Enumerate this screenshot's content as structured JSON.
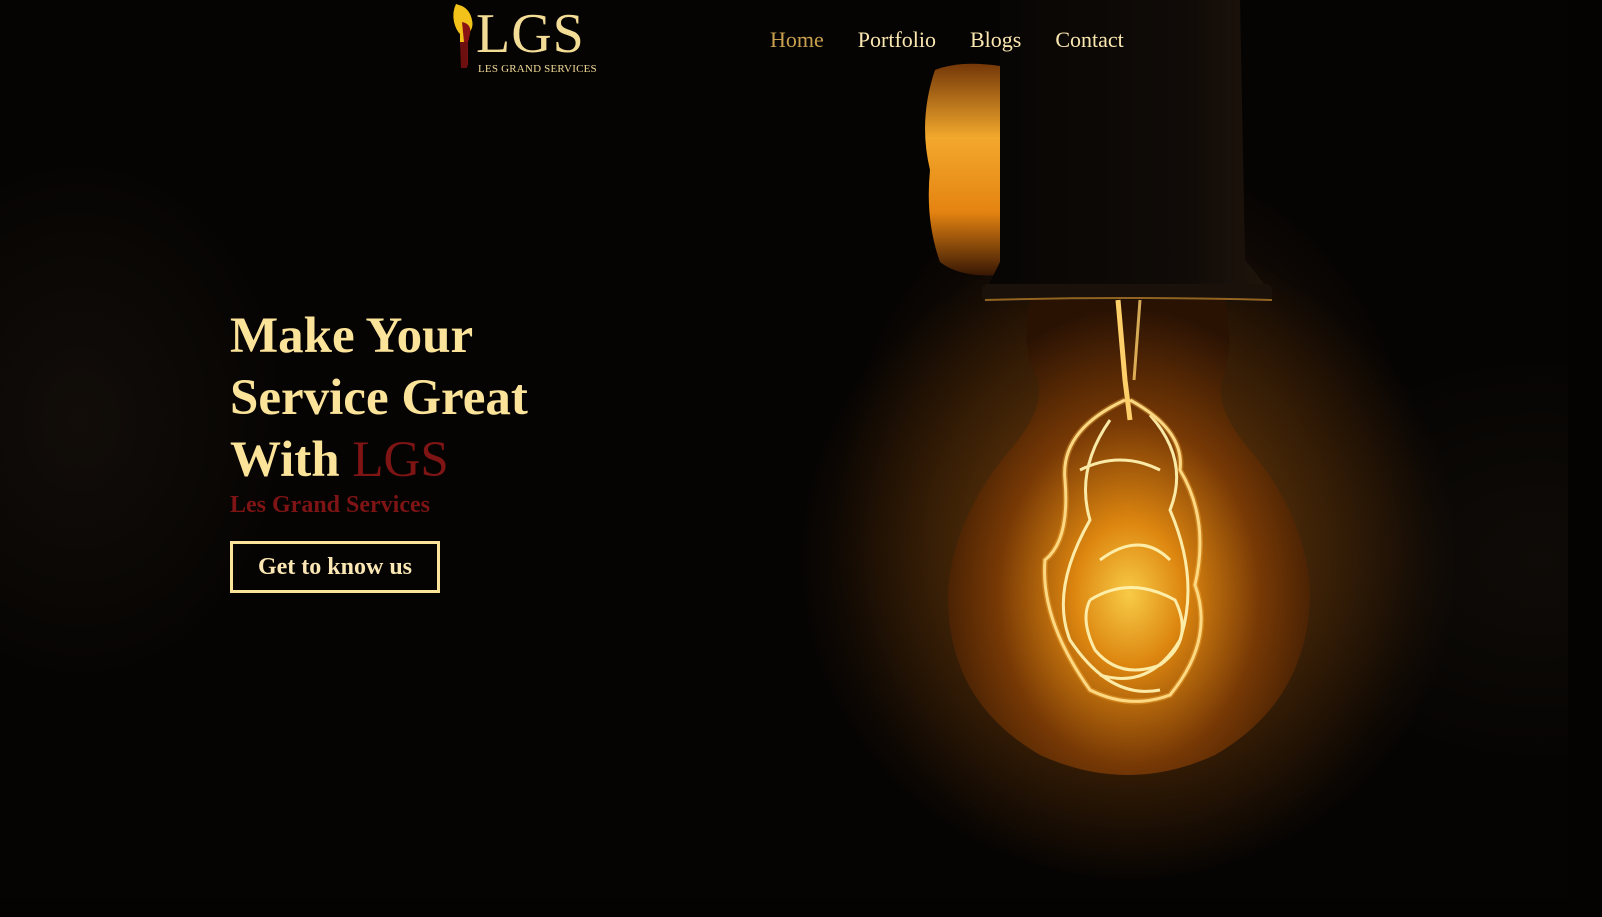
{
  "brand": {
    "logo_letters": "LGS",
    "logo_tagline": "LES GRAND SERVICES",
    "logo_icon": "lightbulb-icon"
  },
  "nav": {
    "items": [
      {
        "label": "Home",
        "active": true
      },
      {
        "label": "Portfolio",
        "active": false
      },
      {
        "label": "Blogs",
        "active": false
      },
      {
        "label": "Contact",
        "active": false
      }
    ]
  },
  "hero": {
    "title_line1": "Make Your",
    "title_line2": "Service Great",
    "title_line3_prefix": "With ",
    "title_accent": "LGS",
    "subtitle": "Les Grand Services",
    "cta_label": "Get to know us"
  },
  "colors": {
    "gold": "#fbe39a",
    "nav_active": "#c9a14e",
    "accent_red": "#7e1414",
    "background": "#060403"
  }
}
